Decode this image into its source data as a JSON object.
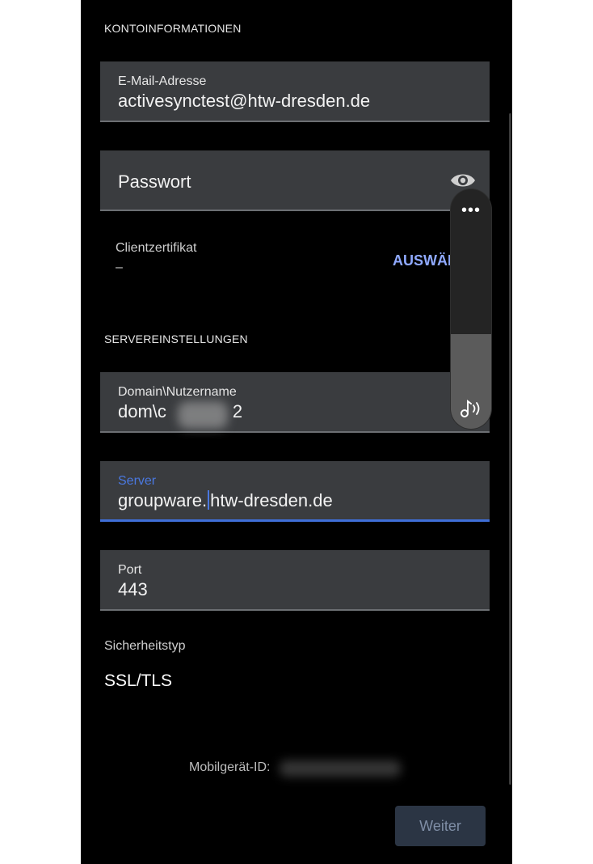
{
  "account_section": {
    "title": "KONTOINFORMATIONEN",
    "email": {
      "label": "E-Mail-Adresse",
      "value": "activesynctest@htw-dresden.de"
    },
    "password": {
      "placeholder": "Passwort"
    },
    "client_cert": {
      "label": "Clientzertifikat",
      "value": "–",
      "action_label": "AUSWÄHLEN"
    }
  },
  "server_section": {
    "title": "SERVEREINSTELLUNGEN",
    "domain_user": {
      "label": "Domain\\Nutzername",
      "value_prefix": "dom\\c",
      "value_suffix": "2"
    },
    "server": {
      "label": "Server",
      "value_before_caret": "groupware.",
      "value_after_caret": "htw-dresden.de"
    },
    "port": {
      "label": "Port",
      "value": "443"
    },
    "security": {
      "label": "Sicherheitstyp",
      "value": "SSL/TLS"
    }
  },
  "device": {
    "label": "Mobilgerät-ID:"
  },
  "next_button": {
    "label": "Weiter"
  },
  "volume_panel": {
    "level": 0.395,
    "more_label": "•••"
  },
  "colors": {
    "accent": "#3f6fd8",
    "link": "#8fa9ff",
    "field_bg": "#3a3c3f",
    "background": "#000000"
  },
  "icons": {
    "password_toggle": "eye-icon",
    "volume": "music-note-icon",
    "more": "more-dots-icon"
  }
}
